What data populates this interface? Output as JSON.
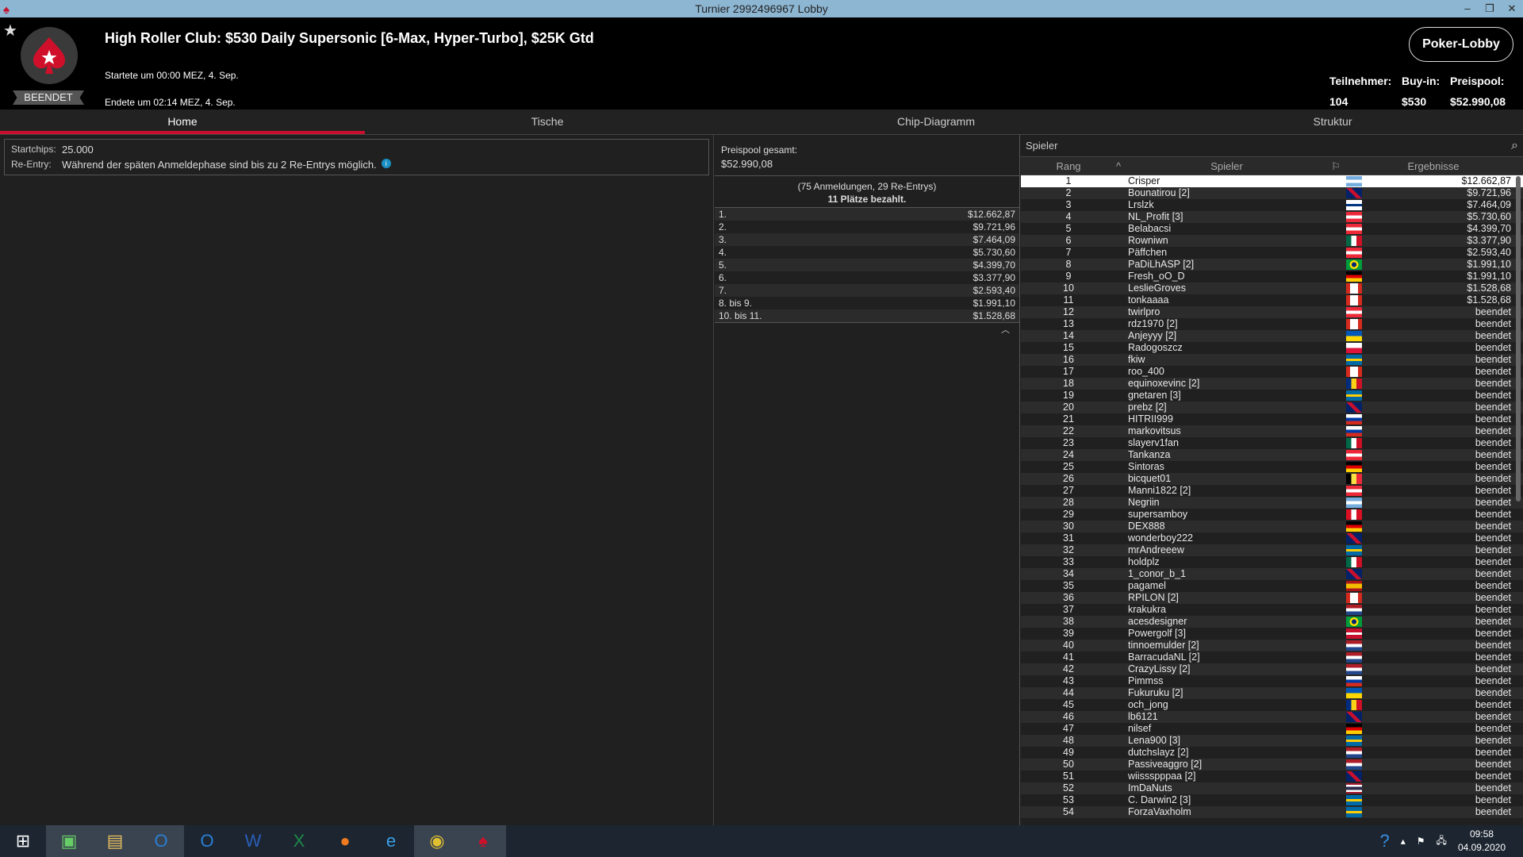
{
  "window": {
    "title": "Turnier 2992496967 Lobby"
  },
  "header": {
    "title": "High Roller Club: $530 Daily Supersonic [6-Max, Hyper-Turbo], $25K Gtd",
    "started": "Startete um 00:00 MEZ, 4. Sep.",
    "ended": "Endete um 02:14 MEZ, 4. Sep.",
    "status_badge": "BEENDET",
    "lobby_button": "Poker-Lobby",
    "stats": [
      {
        "label": "Teilnehmer:",
        "value": "104"
      },
      {
        "label": "Buy-in:",
        "value": "$530"
      },
      {
        "label": "Preispool:",
        "value": "$52.990,08"
      }
    ]
  },
  "tabs": [
    {
      "label": "Home",
      "active": true
    },
    {
      "label": "Tische"
    },
    {
      "label": "Chip-Diagramm"
    },
    {
      "label": "Struktur"
    }
  ],
  "info": {
    "startchips_label": "Startchips:",
    "startchips": "25.000",
    "reentry_label": "Re-Entry:",
    "reentry": "Während der späten Anmeldephase sind bis zu 2 Re-Entrys möglich."
  },
  "prizepool": {
    "label": "Preispool gesamt:",
    "value": "$52.990,08",
    "entries": "(75 Anmeldungen, 29 Re-Entrys)",
    "paid": "11 Plätze bezahlt.",
    "payouts": [
      [
        "1.",
        "$12.662,87"
      ],
      [
        "2.",
        "$9.721,96"
      ],
      [
        "3.",
        "$7.464,09"
      ],
      [
        "4.",
        "$5.730,60"
      ],
      [
        "5.",
        "$4.399,70"
      ],
      [
        "6.",
        "$3.377,90"
      ],
      [
        "7.",
        "$2.593,40"
      ],
      [
        "8. bis 9.",
        "$1.991,10"
      ],
      [
        "10. bis 11.",
        "$1.528,68"
      ]
    ]
  },
  "players": {
    "search_label": "Spieler",
    "col_rank": "Rang",
    "col_player": "Spieler",
    "col_result": "Ergebnisse",
    "rows": [
      [
        1,
        "Crisper",
        "ar",
        "$12.662,87"
      ],
      [
        2,
        "Bounatirou [2]",
        "gb",
        "$9.721,96"
      ],
      [
        3,
        "Lrslzk",
        "fi",
        "$7.464,09"
      ],
      [
        4,
        "NL_Profit [3]",
        "at",
        "$5.730,60"
      ],
      [
        5,
        "Belabacsi",
        "at",
        "$4.399,70"
      ],
      [
        6,
        "Rowniwn",
        "mx",
        "$3.377,90"
      ],
      [
        7,
        "Päffchen",
        "at",
        "$2.593,40"
      ],
      [
        8,
        "PaDiLhASP [2]",
        "br",
        "$1.991,10"
      ],
      [
        9,
        "Fresh_oO_D",
        "de",
        "$1.991,10"
      ],
      [
        10,
        "LeslieGroves",
        "ca",
        "$1.528,68"
      ],
      [
        11,
        "tonkaaaa",
        "ca",
        "$1.528,68"
      ],
      [
        12,
        "twirlpro",
        "at",
        "beendet"
      ],
      [
        13,
        "rdz1970 [2]",
        "ca",
        "beendet"
      ],
      [
        14,
        "Anjeyyy [2]",
        "ua",
        "beendet"
      ],
      [
        15,
        "Radogoszcz",
        "pl",
        "beendet"
      ],
      [
        16,
        "fkiw",
        "se",
        "beendet"
      ],
      [
        17,
        "roo_400",
        "ca",
        "beendet"
      ],
      [
        18,
        "equinoxevinc [2]",
        "ro",
        "beendet"
      ],
      [
        19,
        "gnetaren [3]",
        "se",
        "beendet"
      ],
      [
        20,
        "prebz [2]",
        "gb",
        "beendet"
      ],
      [
        21,
        "HITRII999",
        "ru",
        "beendet"
      ],
      [
        22,
        "markovitsus",
        "ru",
        "beendet"
      ],
      [
        23,
        "slayerv1fan",
        "mx",
        "beendet"
      ],
      [
        24,
        "Tankanza",
        "at",
        "beendet"
      ],
      [
        25,
        "Sintoras",
        "de",
        "beendet"
      ],
      [
        26,
        "bicquet01",
        "be",
        "beendet"
      ],
      [
        27,
        "Manni1822 [2]",
        "at",
        "beendet"
      ],
      [
        28,
        "Negriin",
        "ar",
        "beendet"
      ],
      [
        29,
        "supersamboy",
        "pe",
        "beendet"
      ],
      [
        30,
        "DEX888",
        "de",
        "beendet"
      ],
      [
        31,
        "wonderboy222",
        "gb",
        "beendet"
      ],
      [
        32,
        "mrAndreeew",
        "se",
        "beendet"
      ],
      [
        33,
        "holdplz",
        "mx",
        "beendet"
      ],
      [
        34,
        "1_conor_b_1",
        "gb",
        "beendet"
      ],
      [
        35,
        "pagamel",
        "es",
        "beendet"
      ],
      [
        36,
        "RPILON [2]",
        "ca",
        "beendet"
      ],
      [
        37,
        "krakukra",
        "nl",
        "beendet"
      ],
      [
        38,
        "acesdesigner",
        "br",
        "beendet"
      ],
      [
        39,
        "Powergolf [3]",
        "dk",
        "beendet"
      ],
      [
        40,
        "tinnoemulder [2]",
        "nl",
        "beendet"
      ],
      [
        41,
        "BarracudaNL [2]",
        "nl",
        "beendet"
      ],
      [
        42,
        "CrazyLissy [2]",
        "nl",
        "beendet"
      ],
      [
        43,
        "Pimmss",
        "ru",
        "beendet"
      ],
      [
        44,
        "Fukuruku [2]",
        "ua",
        "beendet"
      ],
      [
        45,
        "och_jong",
        "ro",
        "beendet"
      ],
      [
        46,
        "lb6121",
        "gb",
        "beendet"
      ],
      [
        47,
        "nilsef",
        "de",
        "beendet"
      ],
      [
        48,
        "Lena900 [3]",
        "se",
        "beendet"
      ],
      [
        49,
        "dutchslayz [2]",
        "nl",
        "beendet"
      ],
      [
        50,
        "Passiveaggro [2]",
        "nl",
        "beendet"
      ],
      [
        51,
        "wiissspppaa [2]",
        "gb",
        "beendet"
      ],
      [
        52,
        "ImDaNuts",
        "th",
        "beendet"
      ],
      [
        53,
        "C. Darwin2 [3]",
        "se",
        "beendet"
      ],
      [
        54,
        "ForzaVaxholm",
        "se",
        "beendet"
      ]
    ]
  },
  "taskbar": {
    "time": "09:58",
    "date": "04.09.2020"
  },
  "colors": {
    "accent": "#c8102e",
    "titlebar": "#8db6d2"
  }
}
